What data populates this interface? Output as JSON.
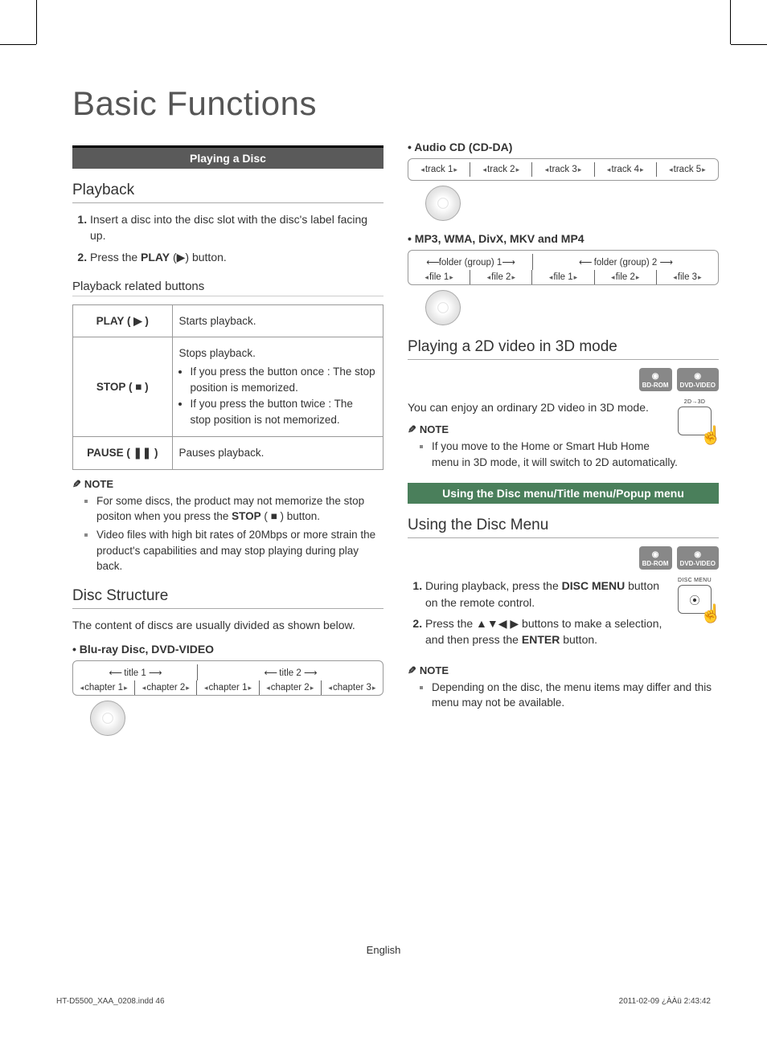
{
  "page_title": "Basic Functions",
  "banner_playing_disc": "Playing a Disc",
  "section_playback": "Playback",
  "playback_steps": [
    {
      "pre": "Insert a disc into the disc slot with the disc's label facing up."
    },
    {
      "pre": "Press the ",
      "bold": "PLAY",
      "post": " (▶) button."
    }
  ],
  "playback_related_heading": "Playback related buttons",
  "button_table": [
    {
      "name": "PLAY ( ▶ )",
      "desc": "Starts playback."
    },
    {
      "name": "STOP ( ■ )",
      "desc": "Stops playback.",
      "bullets": [
        "If you press the button once : The stop position is memorized.",
        "If you press the button twice : The stop position is not memorized."
      ]
    },
    {
      "name": "PAUSE ( ❚❚ )",
      "desc": "Pauses playback."
    }
  ],
  "note_label": "NOTE",
  "playback_notes": [
    {
      "pre": "For some discs, the product may not memorize the stop positon when you press the ",
      "bold": "STOP",
      "post": " ( ■ ) button."
    },
    {
      "pre": "Video files with high bit rates of 20Mbps or more strain the product's capabilities and may stop playing during play back."
    }
  ],
  "section_disc_structure": "Disc Structure",
  "disc_structure_intro": "The content of discs are usually divided as shown below.",
  "bluray_heading": "• Blu-ray Disc, DVD-VIDEO",
  "bluray_titles": [
    "title 1",
    "title 2"
  ],
  "bluray_chapters": [
    "chapter 1",
    "chapter 2",
    "chapter 1",
    "chapter 2",
    "chapter 3"
  ],
  "audiocd_heading": "• Audio CD (CD-DA)",
  "audiocd_tracks": [
    "track 1",
    "track 2",
    "track 3",
    "track 4",
    "track 5"
  ],
  "mp3_heading": "• MP3, WMA, DivX, MKV and MP4",
  "mp3_folders": [
    "folder (group) 1",
    "folder (group) 2"
  ],
  "mp3_files": [
    "file 1",
    "file 2",
    "file 1",
    "file 2",
    "file 3"
  ],
  "section_2d3d": "Playing a 2D video in 3D mode",
  "badges_2d3d": [
    "BD-ROM",
    "DVD-VIDEO"
  ],
  "btn_2d3d_label": "2D→3D",
  "text_2d3d": "You can enjoy an ordinary 2D video in 3D mode.",
  "notes_2d3d": [
    "If you move to the Home or Smart Hub Home menu in 3D mode, it will switch to 2D automatically."
  ],
  "banner_disc_menu": "Using the Disc menu/Title menu/Popup menu",
  "section_disc_menu": "Using the Disc Menu",
  "badges_disc_menu": [
    "BD-ROM",
    "DVD-VIDEO"
  ],
  "btn_discmenu_label": "DISC MENU",
  "disc_menu_steps": [
    {
      "pre": "During playback, press the ",
      "bold": "DISC MENU",
      "post": "  button on the remote control."
    },
    {
      "pre": "Press the ▲▼◀ ▶ buttons to make a selection, and then press the ",
      "bold": "ENTER",
      "post": " button."
    }
  ],
  "disc_menu_notes": [
    "Depending on the disc, the menu items may differ and this menu may not be available."
  ],
  "footer_lang": "English",
  "meta_left": "HT-D5500_XAA_0208.indd   46",
  "meta_right": "2011-02-09   ¿ÀÀü 2:43:42"
}
